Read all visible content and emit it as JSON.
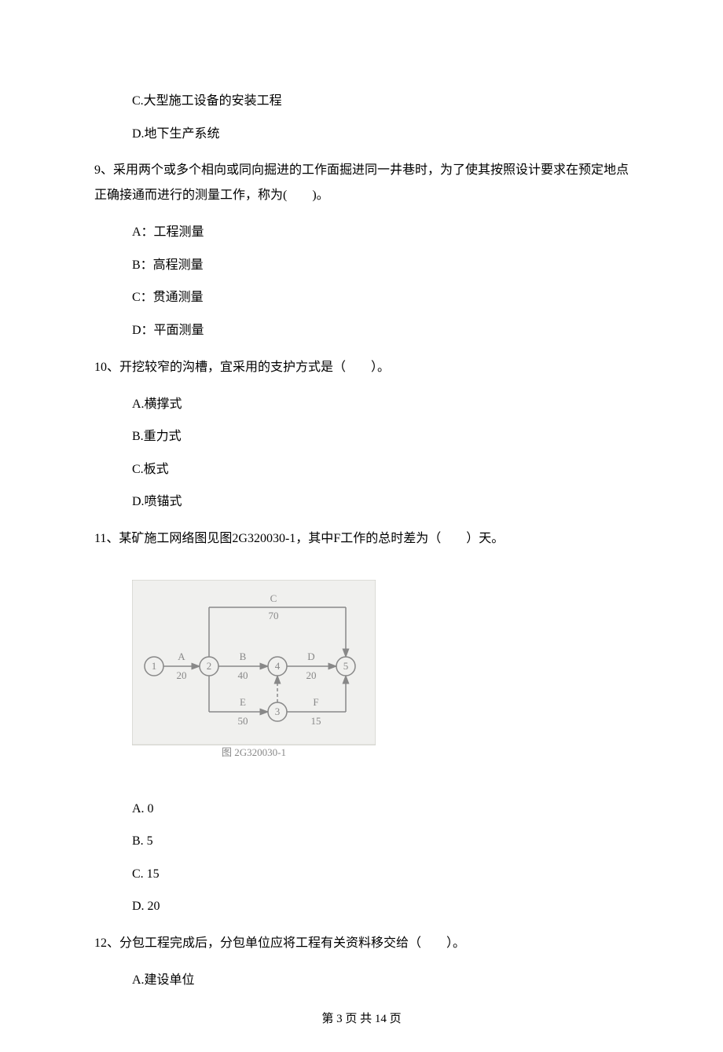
{
  "partial_q8": {
    "optC": "C.大型施工设备的安装工程",
    "optD": "D.地下生产系统"
  },
  "q9": {
    "stem": "9、采用两个或多个相向或同向掘进的工作面掘进同一井巷时，为了使其按照设计要求在预定地点正确接通而进行的测量工作，称为(　　)。",
    "optA": "A：工程测量",
    "optB": "B：高程测量",
    "optC": "C：贯通测量",
    "optD": "D：平面测量"
  },
  "q10": {
    "stem": "10、开挖较窄的沟槽，宜采用的支护方式是（　　）。",
    "optA": "A.横撑式",
    "optB": "B.重力式",
    "optC": "C.板式",
    "optD": "D.喷锚式"
  },
  "q11": {
    "stem": "11、某矿施工网络图见图2G320030-1，其中F工作的总时差为（　　）天。",
    "optA": "A.  0",
    "optB": "B.  5",
    "optC": "C.  15",
    "optD": "D.  20",
    "diagram": {
      "caption": "图 2G320030-1",
      "nodes": [
        "1",
        "2",
        "3",
        "4",
        "5"
      ],
      "edges": [
        {
          "label": "A",
          "value": 20,
          "from": 1,
          "to": 2
        },
        {
          "label": "B",
          "value": 40,
          "from": 2,
          "to": 4
        },
        {
          "label": "C",
          "value": 70,
          "from": 2,
          "to": 5
        },
        {
          "label": "D",
          "value": 20,
          "from": 4,
          "to": 5
        },
        {
          "label": "E",
          "value": 50,
          "from": 2,
          "to": 3
        },
        {
          "label": "F",
          "value": 15,
          "from": 3,
          "to": 5
        }
      ],
      "dummy": {
        "from": 3,
        "to": 4
      }
    }
  },
  "q12": {
    "stem": "12、分包工程完成后，分包单位应将工程有关资料移交给（　　）。",
    "optA": "A.建设单位"
  },
  "footer": "第 3 页 共 14 页"
}
